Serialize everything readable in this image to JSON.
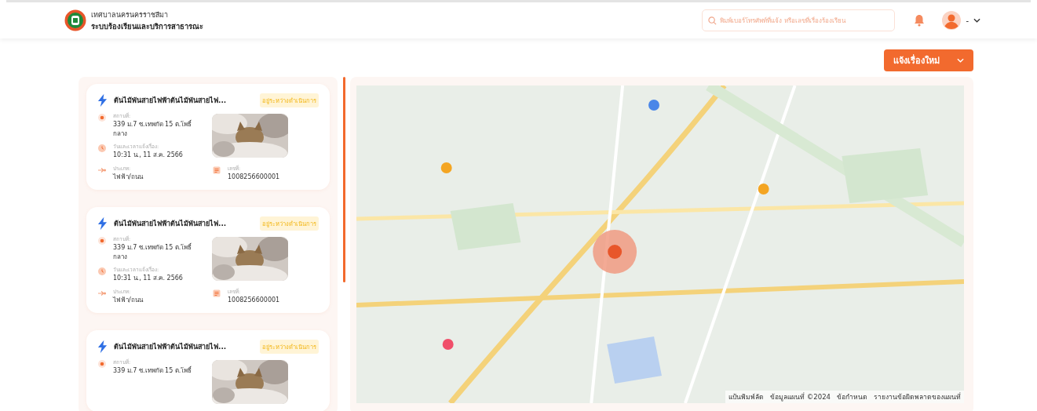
{
  "header": {
    "org_name": "เทศบาลนครนครราชสีมา",
    "system_name": "ระบบร้องเรียนและบริการสาธารณะ",
    "search_placeholder": "พิมพ์เบอร์โทรศัพท์ที่แจ้ง หรือเลขที่เรื่องร้องเรียน",
    "user_name": "-"
  },
  "new_button": {
    "label": "แจ้งเรื่องใหม่"
  },
  "complaints": [
    {
      "title": "ต้นไม้พันสายไฟฟ้าต้นไม้พันสายไฟ...",
      "status": "อยู่ระหว่างดำเนินการ",
      "location_label": "สถานที่:",
      "location": "339 ม.7 ซ.เทพกัด 15 ต.โพธิ์กลาง",
      "datetime_label": "วันและเวลาแจ้งเรื่อง:",
      "datetime": "10:31 น., 11 ส.ค. 2566",
      "type_label": "ประเภท:",
      "type": "ไฟฟ้า/ถนน",
      "number_label": "เลขที่:",
      "number": "1008256600001"
    },
    {
      "title": "ต้นไม้พันสายไฟฟ้าต้นไม้พันสายไฟ...",
      "status": "อยู่ระหว่างดำเนินการ",
      "location_label": "สถานที่:",
      "location": "339 ม.7 ซ.เทพกัด 15 ต.โพธิ์กลาง",
      "datetime_label": "วันและเวลาแจ้งเรื่อง:",
      "datetime": "10:31 น., 11 ส.ค. 2566",
      "type_label": "ประเภท:",
      "type": "ไฟฟ้า/ถนน",
      "number_label": "เลขที่:",
      "number": "1008256600001"
    },
    {
      "title": "ต้นไม้พันสายไฟฟ้าต้นไม้พันสายไฟ...",
      "status": "อยู่ระหว่างดำเนินการ",
      "location_label": "สถานที่:",
      "location": "339 ม.7 ซ.เทพกัด 15 ต.โพธิ์"
    }
  ],
  "map": {
    "attribution": [
      "แป้นพิมพ์ลัด",
      "ข้อมูลแผนที่ ©2024",
      "ข้อกำหนด",
      "รายงานข้อผิดพลาดของแผนที่"
    ]
  }
}
